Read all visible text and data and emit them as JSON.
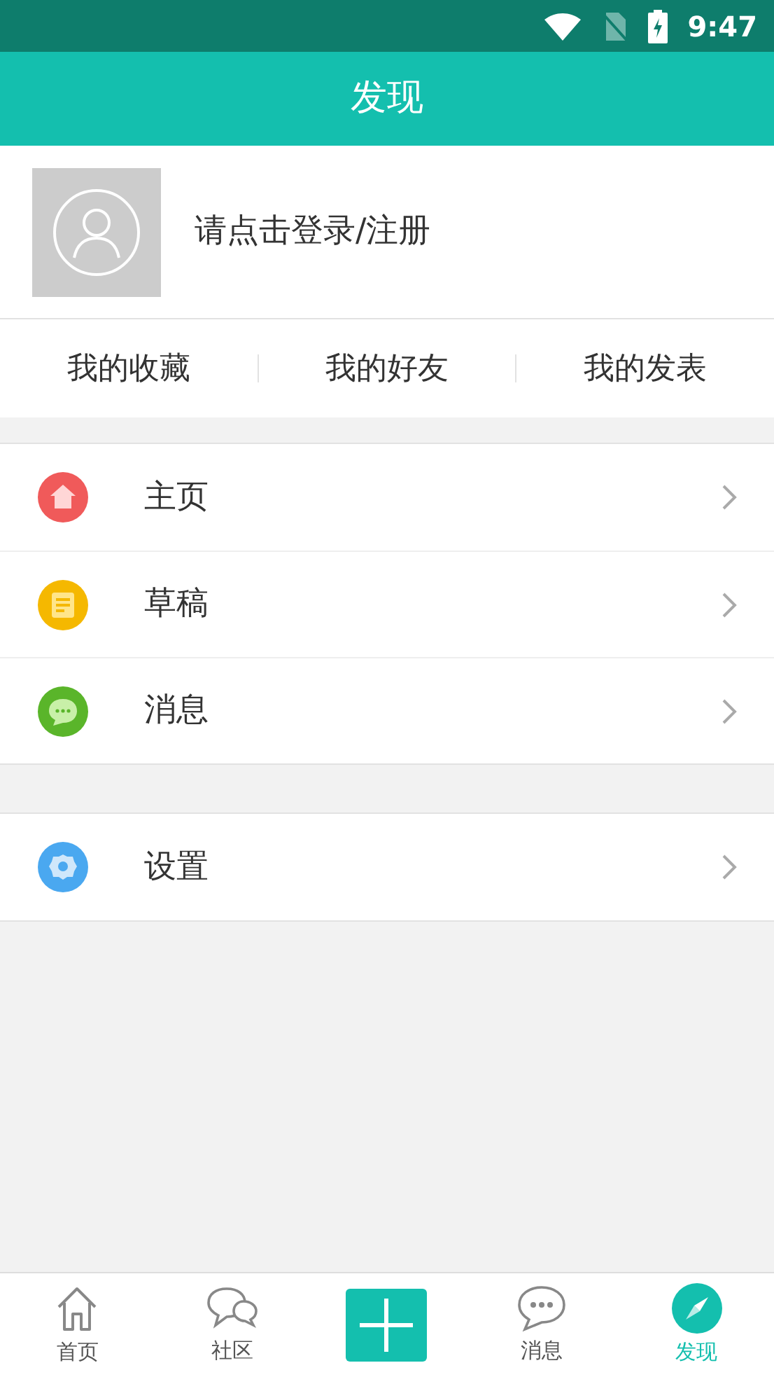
{
  "status_bar": {
    "time": "9:47"
  },
  "header": {
    "title": "发现"
  },
  "profile": {
    "login_text": "请点击登录/注册"
  },
  "quick_links": [
    "我的收藏",
    "我的好友",
    "我的发表"
  ],
  "menu_groups": [
    {
      "items": [
        {
          "kind": "home",
          "label": "主页"
        },
        {
          "kind": "draft",
          "label": "草稿"
        },
        {
          "kind": "message",
          "label": "消息"
        }
      ]
    },
    {
      "items": [
        {
          "kind": "settings",
          "label": "设置"
        }
      ]
    }
  ],
  "bottom_nav": [
    {
      "kind": "home",
      "label": "首页",
      "selected": false
    },
    {
      "kind": "community",
      "label": "社区",
      "selected": false
    },
    {
      "kind": "add"
    },
    {
      "kind": "message",
      "label": "消息",
      "selected": false
    },
    {
      "kind": "discover",
      "label": "发现",
      "selected": true
    }
  ]
}
